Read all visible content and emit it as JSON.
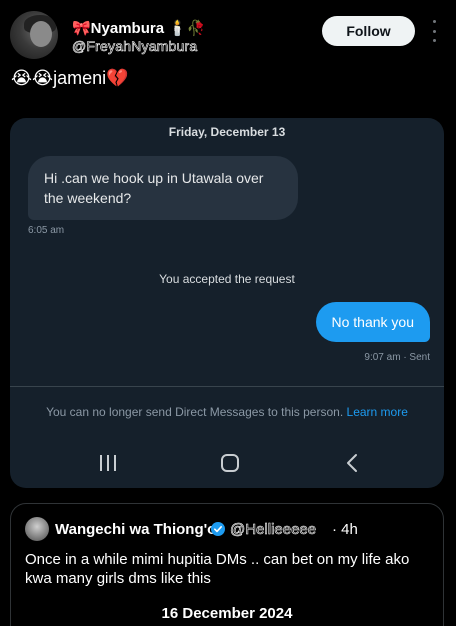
{
  "post": {
    "author_name": "🎀Nyambura 🕯️🥀",
    "author_handle": "@FreyahNyambura",
    "follow_label": "Follow",
    "caption": "😭😭jameni💔"
  },
  "dm": {
    "date": "Friday, December 13",
    "incoming_message": "Hi .can we hook up in Utawala over the weekend?",
    "incoming_time": "6:05 am",
    "system_message": "You accepted the request",
    "outgoing_message": "No thank you",
    "outgoing_time": "9:07 am · Sent",
    "notice": "You can no longer send Direct Messages to this person.",
    "notice_link": "Learn more"
  },
  "quote": {
    "author_name": "Wangechi wa Thiong'o",
    "author_handle": "@Hellieeeee",
    "time": "· 4h",
    "text": "Once in a while mimi hupitia DMs .. can bet on my life ako kwa many girls dms like this",
    "date": "16 December 2024"
  },
  "colors": {
    "background": "#000000",
    "dm_card": "#15202b",
    "incoming_bubble": "#273340",
    "outgoing_bubble": "#1d9bf0",
    "link": "#1d9bf0",
    "verified": "#1d9bf0"
  },
  "icons": [
    "more-vertical-icon",
    "recents-icon",
    "home-icon",
    "back-icon",
    "verified-badge-icon"
  ]
}
